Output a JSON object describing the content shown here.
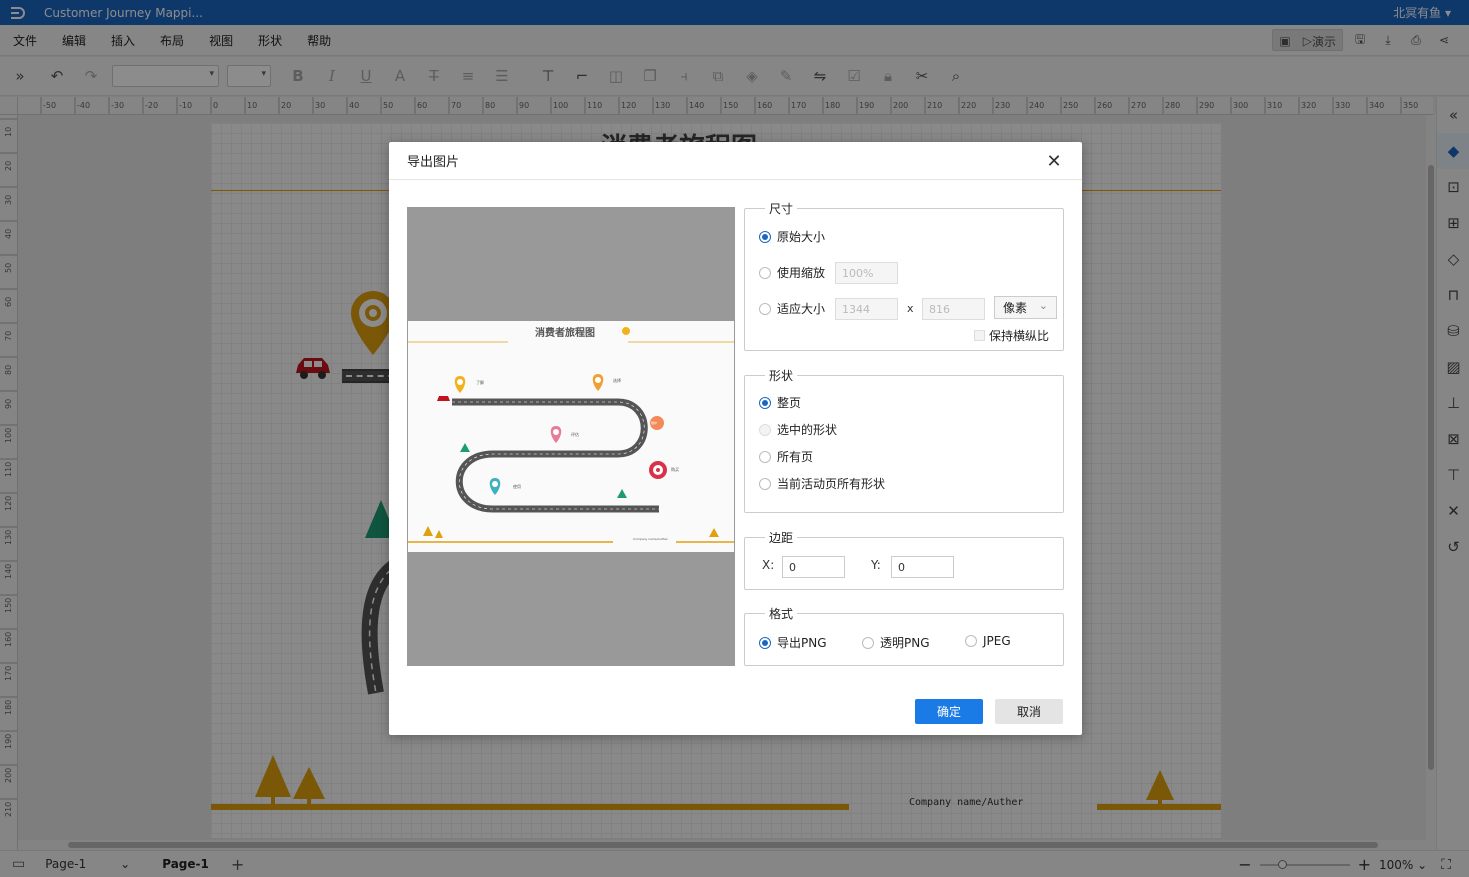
{
  "app": {
    "title": "Customer Journey Mappi...",
    "user": "北冥有鱼"
  },
  "menu": [
    "文件",
    "编辑",
    "插入",
    "布局",
    "视图",
    "形状",
    "帮助"
  ],
  "present_label": "演示",
  "ruler_h": [
    "-50",
    "-40",
    "-30",
    "-20",
    "-10",
    "0",
    "10",
    "20",
    "30",
    "40",
    "50",
    "60",
    "70",
    "80",
    "90",
    "100",
    "110",
    "120",
    "130",
    "140",
    "150",
    "160",
    "170",
    "180",
    "190",
    "200",
    "210",
    "220",
    "230",
    "240",
    "250",
    "260",
    "270",
    "280",
    "290",
    "300",
    "310",
    "320",
    "330",
    "340",
    "350"
  ],
  "ruler_v": [
    "10",
    "20",
    "30",
    "40",
    "50",
    "60",
    "70",
    "80",
    "90",
    "100",
    "110",
    "120",
    "130",
    "140",
    "150",
    "160",
    "170",
    "180",
    "190",
    "200",
    "210"
  ],
  "canvas": {
    "footer_text": "Company name/Auther",
    "title_partial": "消费者旅程图"
  },
  "dialog": {
    "title": "导出图片",
    "size": {
      "legend": "尺寸",
      "original": "原始大小",
      "zoom": "使用缩放",
      "zoom_value": "100%",
      "fit": "适应大小",
      "width": "1344",
      "height": "816",
      "times": "x",
      "unit": "像素",
      "keep_ratio": "保持横纵比"
    },
    "shape": {
      "legend": "形状",
      "options": [
        "整页",
        "选中的形状",
        "所有页",
        "当前活动页所有形状"
      ]
    },
    "margin": {
      "legend": "边距",
      "x_label": "X:",
      "x_value": "0",
      "y_label": "Y:",
      "y_value": "0"
    },
    "format": {
      "legend": "格式",
      "options": [
        "导出PNG",
        "透明PNG",
        "JPEG"
      ]
    },
    "ok": "确定",
    "cancel": "取消",
    "preview": {
      "title": "消费者旅程图",
      "labels": [
        "了解",
        "选择",
        "评估",
        "购买",
        "使用",
        "维护"
      ],
      "footer": "Company name/Auther"
    }
  },
  "status": {
    "page_select": "Page-1",
    "page_tab": "Page-1",
    "add": "+",
    "zoom": "100%"
  },
  "colors": {
    "accent": "#1b66c1",
    "primary_btn": "#1a7ae6",
    "orange": "#e0a010",
    "road": "#555555"
  }
}
